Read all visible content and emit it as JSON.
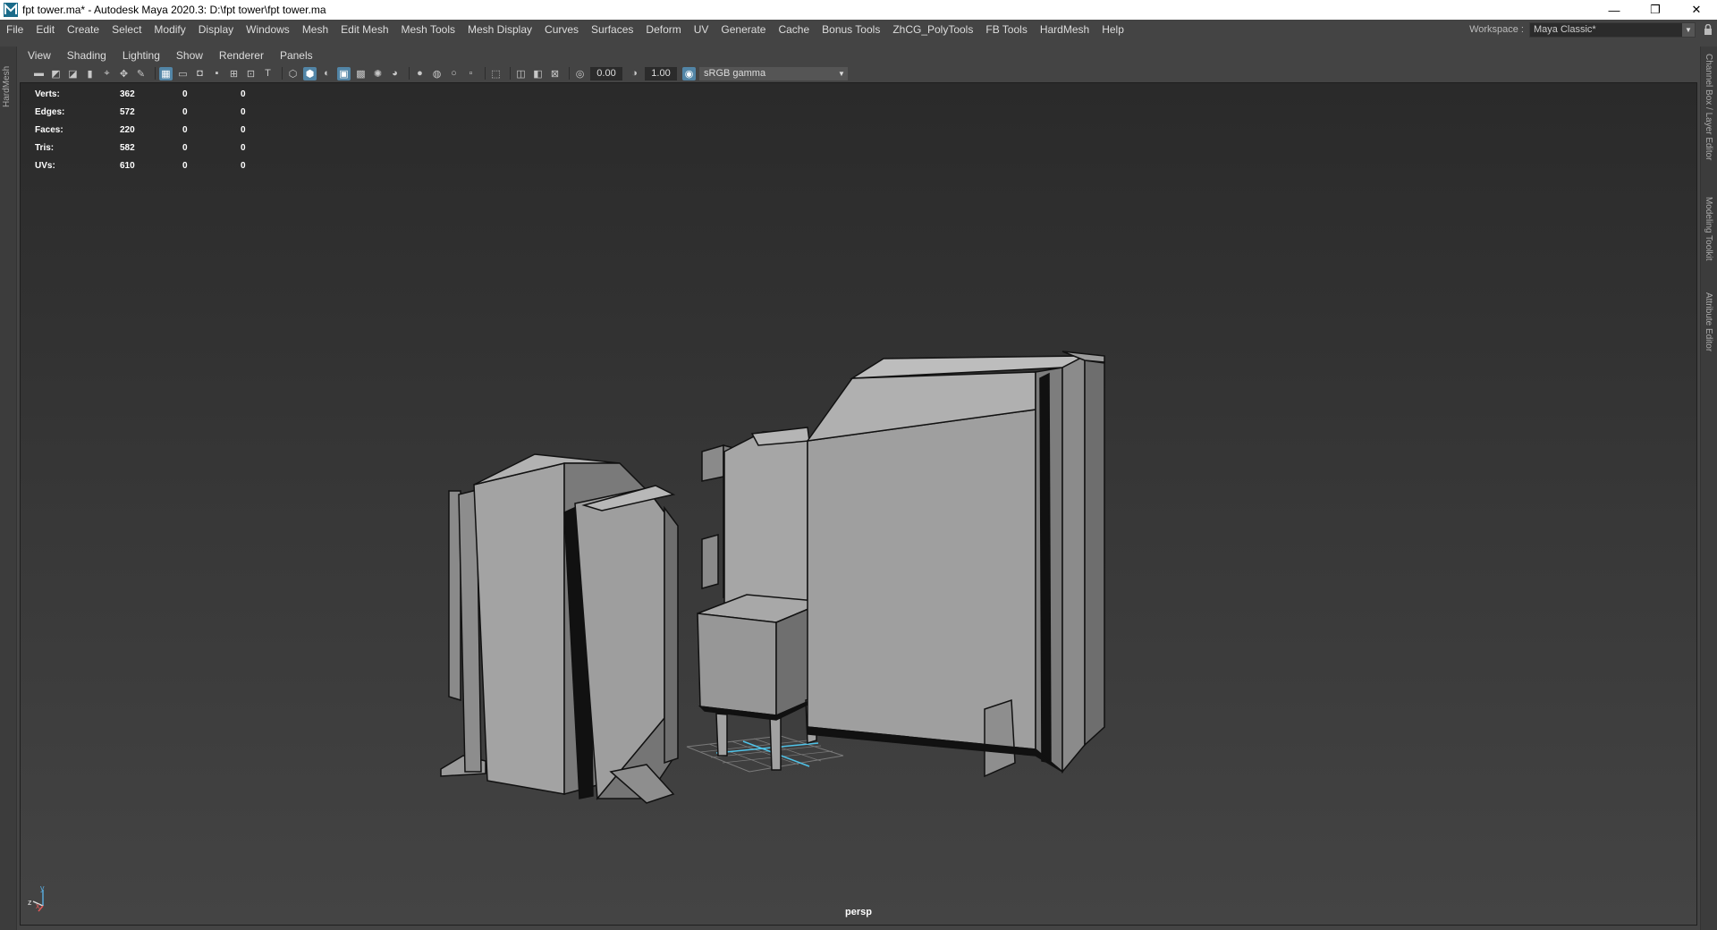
{
  "window": {
    "title": "fpt tower.ma* - Autodesk Maya 2020.3: D:\\fpt tower\\fpt tower.ma",
    "minimize": "—",
    "restore": "❐",
    "close": "✕"
  },
  "menu": {
    "items": [
      "File",
      "Edit",
      "Create",
      "Select",
      "Modify",
      "Display",
      "Windows",
      "Mesh",
      "Edit Mesh",
      "Mesh Tools",
      "Mesh Display",
      "Curves",
      "Surfaces",
      "Deform",
      "UV",
      "Generate",
      "Cache",
      "Bonus Tools",
      "ZhCG_PolyTools",
      "FB Tools",
      "HardMesh",
      "Help"
    ]
  },
  "workspace": {
    "label": "Workspace :",
    "value": "Maya Classic*"
  },
  "left_strip": {
    "tab": "HardMesh"
  },
  "right_strip": {
    "tabs": [
      "Channel Box / Layer Editor",
      "Modeling Toolkit",
      "Attribute Editor"
    ]
  },
  "panel_menu": {
    "items": [
      "View",
      "Shading",
      "Lighting",
      "Show",
      "Renderer",
      "Panels"
    ]
  },
  "panel_toolbar": {
    "exposure": "0.00",
    "gamma": "1.00",
    "color_space": "sRGB gamma"
  },
  "hud": {
    "rows": [
      {
        "label": "Verts:",
        "v1": "362",
        "v2": "0",
        "v3": "0"
      },
      {
        "label": "Edges:",
        "v1": "572",
        "v2": "0",
        "v3": "0"
      },
      {
        "label": "Faces:",
        "v1": "220",
        "v2": "0",
        "v3": "0"
      },
      {
        "label": "Tris:",
        "v1": "582",
        "v2": "0",
        "v3": "0"
      },
      {
        "label": "UVs:",
        "v1": "610",
        "v2": "0",
        "v3": "0"
      }
    ]
  },
  "viewport": {
    "camera": "persp",
    "axis_y": "y",
    "axis_z": "z",
    "axis_x": "x"
  },
  "colors": {
    "selection_accent": "#5285a6",
    "grid_highlight": "#4fc3e8",
    "mesh_light": "#9b9b9b",
    "mesh_dark": "#6a6a6a"
  }
}
